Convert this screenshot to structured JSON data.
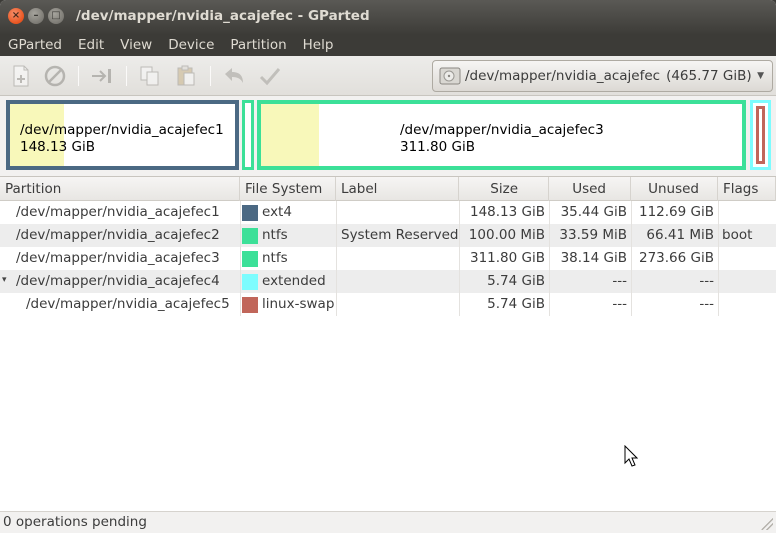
{
  "window": {
    "title": "/dev/mapper/nvidia_acajefec - GParted",
    "buttons": [
      "close",
      "minimize",
      "maximize"
    ]
  },
  "menubar": {
    "items": [
      "GParted",
      "Edit",
      "View",
      "Device",
      "Partition",
      "Help"
    ]
  },
  "toolbar": {
    "icons": [
      "new-partition-icon",
      "delete-icon",
      "resize-move-icon",
      "copy-icon",
      "paste-icon",
      "undo-icon",
      "apply-icon"
    ],
    "device_selector": {
      "device": "/dev/mapper/nvidia_acajefec",
      "size": "(465.77 GiB)"
    }
  },
  "visual": {
    "partitions": [
      {
        "name": "/dev/mapper/nvidia_acajefec1",
        "size": "148.13 GiB",
        "color": "#4b6983",
        "used_fraction": 0.24
      },
      {
        "name": "/dev/mapper/nvidia_acajefec2",
        "color": "#3ce098"
      },
      {
        "name": "/dev/mapper/nvidia_acajefec3",
        "size": "311.80 GiB",
        "color": "#3ce098",
        "used_fraction": 0.12
      },
      {
        "name": "/dev/mapper/nvidia_acajefec4",
        "color": "#7dfcfe"
      },
      {
        "name": "/dev/mapper/nvidia_acajefec5",
        "color": "#c1665a"
      }
    ]
  },
  "table": {
    "headers": [
      "Partition",
      "File System",
      "Label",
      "Size",
      "Used",
      "Unused",
      "Flags"
    ],
    "rows": [
      {
        "partition": "/dev/mapper/nvidia_acajefec1",
        "fs": "ext4",
        "fs_color": "#4b6983",
        "label": "",
        "size": "148.13 GiB",
        "used": "35.44 GiB",
        "unused": "112.69 GiB",
        "flags": ""
      },
      {
        "partition": "/dev/mapper/nvidia_acajefec2",
        "fs": "ntfs",
        "fs_color": "#3ce098",
        "label": "System Reserved",
        "size": "100.00 MiB",
        "used": "33.59 MiB",
        "unused": "66.41 MiB",
        "flags": "boot"
      },
      {
        "partition": "/dev/mapper/nvidia_acajefec3",
        "fs": "ntfs",
        "fs_color": "#3ce098",
        "label": "",
        "size": "311.80 GiB",
        "used": "38.14 GiB",
        "unused": "273.66 GiB",
        "flags": ""
      },
      {
        "partition": "/dev/mapper/nvidia_acajefec4",
        "fs": "extended",
        "fs_color": "#7dfcfe",
        "label": "",
        "size": "5.74 GiB",
        "used": "---",
        "unused": "---",
        "flags": "",
        "expander": "▾"
      },
      {
        "partition": "/dev/mapper/nvidia_acajefec5",
        "fs": "linux-swap",
        "fs_color": "#c1665a",
        "label": "",
        "size": "5.74 GiB",
        "used": "---",
        "unused": "---",
        "flags": ""
      }
    ]
  },
  "status": {
    "text": "0 operations pending"
  }
}
